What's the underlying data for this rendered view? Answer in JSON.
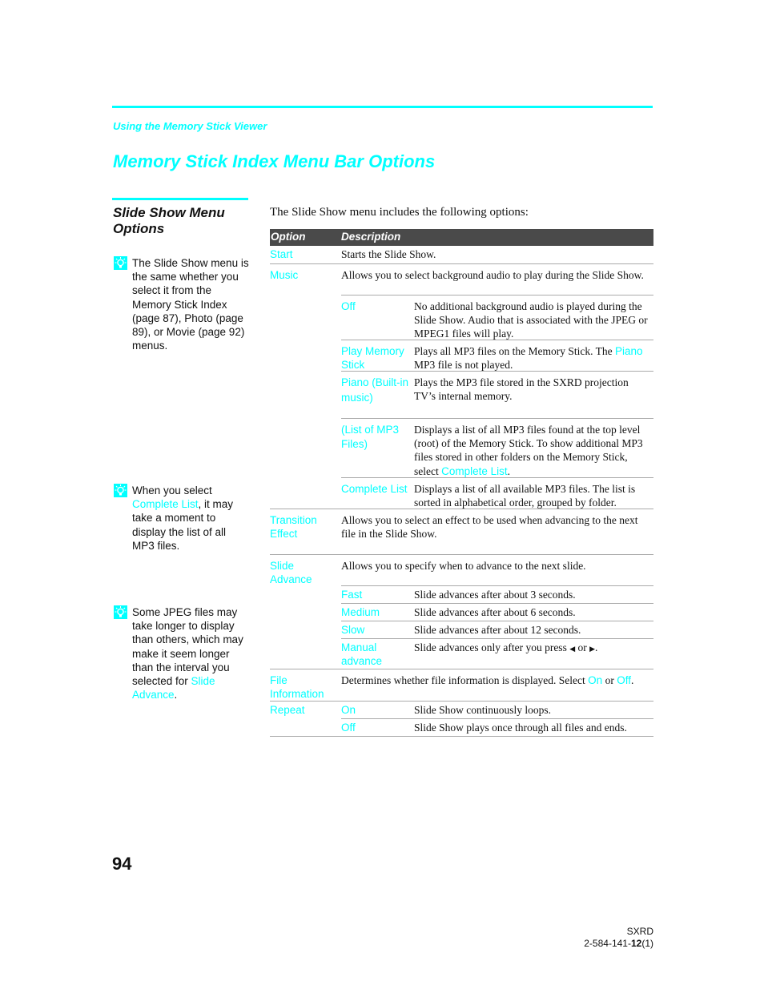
{
  "header": {
    "running_head": "Using the Memory Stick Viewer",
    "title": "Memory Stick Index Menu Bar Options"
  },
  "sidebar": {
    "heading_line1": "Slide Show Menu",
    "heading_line2": "Options",
    "tips": [
      {
        "icon": "lightbulb-icon",
        "text": "The Slide Show menu is the same whether you select it from the Memory Stick Index (page 87), Photo (page 89), or Movie (page 92) menus."
      },
      {
        "icon": "lightbulb-icon",
        "text_before": "When you select ",
        "link": "Complete List",
        "text_after": ", it may take a moment to display the list of all MP3 files."
      },
      {
        "icon": "lightbulb-icon",
        "text_before": "Some JPEG files may take longer to display than others, which may make it seem longer than the interval you selected for ",
        "link": "Slide Advance",
        "text_after": "."
      }
    ]
  },
  "main": {
    "intro": "The Slide Show menu includes the following options:",
    "table": {
      "headers": [
        "Option",
        "Description"
      ],
      "start": {
        "option": "Start",
        "description": "Starts the Slide Show."
      },
      "music": {
        "option": "Music",
        "description": "Allows you to select background audio to play during the Slide Show.",
        "sub": [
          {
            "option": "Off",
            "description": "No additional background audio is played during the Slide Show. Audio that is associated with the JPEG or MPEG1 files will play."
          },
          {
            "option": "Play Memory Stick",
            "description_link": "Piano",
            "description_before": "Plays all MP3 files on the Memory Stick. The ",
            "description_after": " MP3 file is not played."
          },
          {
            "option": "Piano (Built-in music)",
            "description": "Plays the MP3 file stored in the SXRD projection TV’s internal memory."
          },
          {
            "option": "(List of MP3 Files)",
            "description_before": "Displays a list of all MP3 files found at the top level (root) of the Memory Stick. To show additional MP3 files stored in other folders on the Memory Stick, select ",
            "description_link": "Complete List",
            "description_after": "."
          },
          {
            "option": "Complete List",
            "description": "Displays a list of all available MP3 files. The list is sorted in alphabetical order, grouped by folder."
          }
        ]
      },
      "transition": {
        "option": "Transition Effect",
        "description": "Allows you to select an effect to be used when advancing to the next file in the Slide Show."
      },
      "slide_advance": {
        "option": "Slide Advance",
        "description": "Allows you to specify when to advance to the next slide.",
        "sub": [
          {
            "option": "Fast",
            "description": "Slide advances after about 3 seconds."
          },
          {
            "option": "Medium",
            "description": "Slide advances after about 6 seconds."
          },
          {
            "option": "Slow",
            "description": "Slide advances after about 12 seconds."
          },
          {
            "option": "Manual advance",
            "description_before": "Slide advances only after you press ",
            "left_arrow": "◆",
            "or": " or ",
            "right_arrow": "◆",
            "description_after": "."
          }
        ]
      },
      "file_info": {
        "option": "File Information",
        "description_before": "Determines whether file information is displayed. Select ",
        "on": "On",
        "or": " or ",
        "off": "Off",
        "description_after": "."
      },
      "repeat": {
        "option": "Repeat",
        "sub": [
          {
            "option": "On",
            "description": "Slide Show continuously loops."
          },
          {
            "option": "Off",
            "description": "Slide Show plays once through all files and ends."
          }
        ]
      }
    }
  },
  "footer": {
    "page_number": "94",
    "model": "SXRD",
    "code_prefix": "2-584-141-",
    "code_bold": "12",
    "code_suffix": "(1)"
  },
  "colors": {
    "accent": "#00ffff",
    "table_header": "#4a4a4a",
    "rule": "#aaaaaa"
  }
}
